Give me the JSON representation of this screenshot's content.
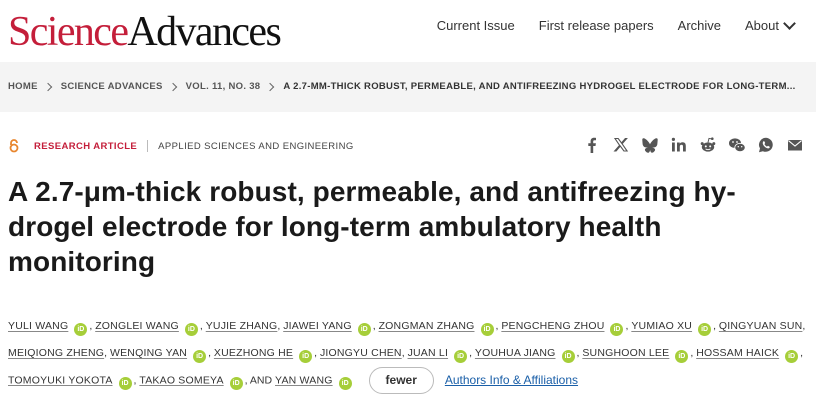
{
  "header": {
    "logo_part1": "Science",
    "logo_part2": "Advances",
    "nav": [
      "Current Issue",
      "First release papers",
      "Archive",
      "About"
    ]
  },
  "breadcrumb": [
    "HOME",
    "SCIENCE ADVANCES",
    "VOL. 11, NO. 38",
    "A 2.7-MM-THICK ROBUST, PERMEABLE, AND ANTIFREEZING HYDROGEL ELECTRODE FOR LONG-TERM..."
  ],
  "article": {
    "type": "RESEARCH ARTICLE",
    "subject": "APPLIED SCIENCES AND ENGINEERING",
    "title": "A 2.7-μm-thick robust, permeable, and antifreezing hy-drogel electrode for long-term ambulatory health monitoring",
    "authors": [
      "YULI WANG",
      "ZONGLEI WANG",
      "YUJIE ZHANG",
      "JIAWEI YANG",
      "ZONGMAN ZHANG",
      "PENGCHENG ZHOU",
      "YUMIAO XU",
      "QINGYUAN SUN",
      "MEIQIONG ZHENG",
      "WENQING YAN",
      "XUEZHONG HE",
      "JIONGYU CHEN",
      "JUAN LI",
      "YOUHUA JIANG",
      "SUNGHOON LEE",
      "HOSSAM HAICK",
      "TOMOYUKI YOKOTA",
      "TAKAO SOMEYA",
      "YAN WANG"
    ],
    "authors_and": ", AND",
    "orcid_label": "iD",
    "fewer_label": "fewer",
    "affiliations_link": "Authors Info & Affiliations"
  },
  "share_icons": [
    "facebook-icon",
    "x-icon",
    "bluesky-icon",
    "linkedin-icon",
    "reddit-icon",
    "wechat-icon",
    "whatsapp-icon",
    "email-icon"
  ],
  "colors": {
    "brand_red": "#c41e3a",
    "orcid_green": "#a6ce39",
    "link_blue": "#1a5fa8"
  }
}
